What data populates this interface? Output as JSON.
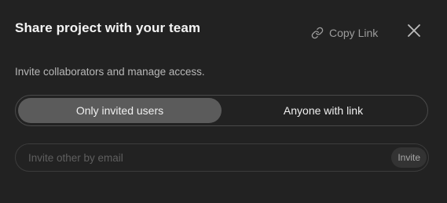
{
  "dialog": {
    "title": "Share project with your team",
    "copy_link_label": "Copy Link",
    "subtitle": "Invite collaborators and manage access.",
    "access_options": [
      {
        "label": "Only invited users",
        "selected": true
      },
      {
        "label": "Anyone with link",
        "selected": false
      }
    ],
    "invite": {
      "placeholder": "Invite other by email",
      "value": "",
      "button_label": "Invite"
    }
  },
  "icons": {
    "copy_link": "link-icon",
    "close": "close-icon"
  },
  "colors": {
    "background": "#222222",
    "selected_segment": "#5b5b5b",
    "muted_text": "#9c9c9c"
  }
}
